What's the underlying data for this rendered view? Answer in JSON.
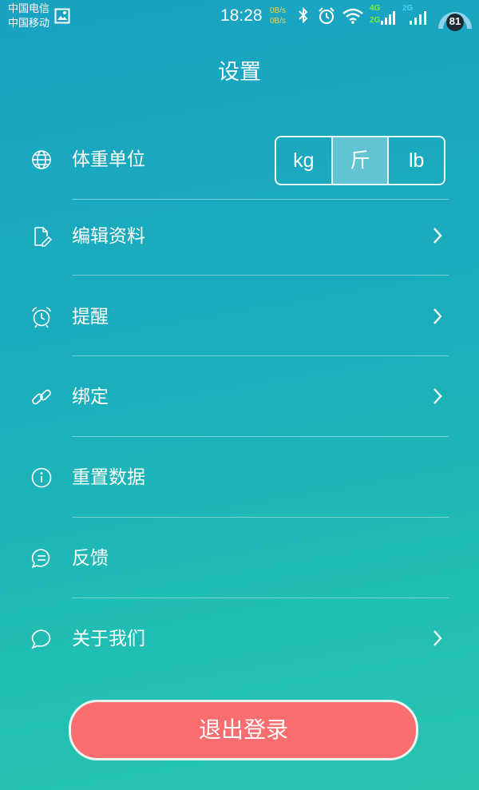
{
  "status_bar": {
    "carrier_1": "中国电信",
    "carrier_2": "中国移动",
    "time": "18:28",
    "net_speed_up": "0B/s",
    "net_speed_down": "0B/s",
    "net_4g": "4G",
    "net_2g_a": "2G",
    "net_2g_b": "2G",
    "battery_level": "81",
    "icons": [
      "image-icon",
      "bluetooth-icon",
      "alarm-icon",
      "wifi-icon",
      "signal-icon",
      "signal-icon",
      "battery-icon"
    ]
  },
  "header": {
    "title": "设置"
  },
  "settings": {
    "weight_unit": {
      "label": "体重单位",
      "icon": "globe-icon",
      "options": [
        "kg",
        "斤",
        "lb"
      ],
      "selected": "斤"
    },
    "items": [
      {
        "label": "编辑资料",
        "icon": "edit-document-icon",
        "has_chevron": true
      },
      {
        "label": "提醒",
        "icon": "alarm-clock-icon",
        "has_chevron": true
      },
      {
        "label": "绑定",
        "icon": "link-icon",
        "has_chevron": true
      },
      {
        "label": "重置数据",
        "icon": "info-icon",
        "has_chevron": false
      },
      {
        "label": "反馈",
        "icon": "feedback-icon",
        "has_chevron": false
      },
      {
        "label": "关于我们",
        "icon": "chat-bubble-icon",
        "has_chevron": true
      }
    ]
  },
  "logout_button": {
    "label": "退出登录"
  },
  "colors": {
    "bg_top": "#19a2c2",
    "bg_bottom": "#27c4ae",
    "logout_bg": "#fa6e6f",
    "speed_text": "#f5d24a",
    "net_4g": "#7be84a",
    "net_2g": "#4ad0ff"
  }
}
